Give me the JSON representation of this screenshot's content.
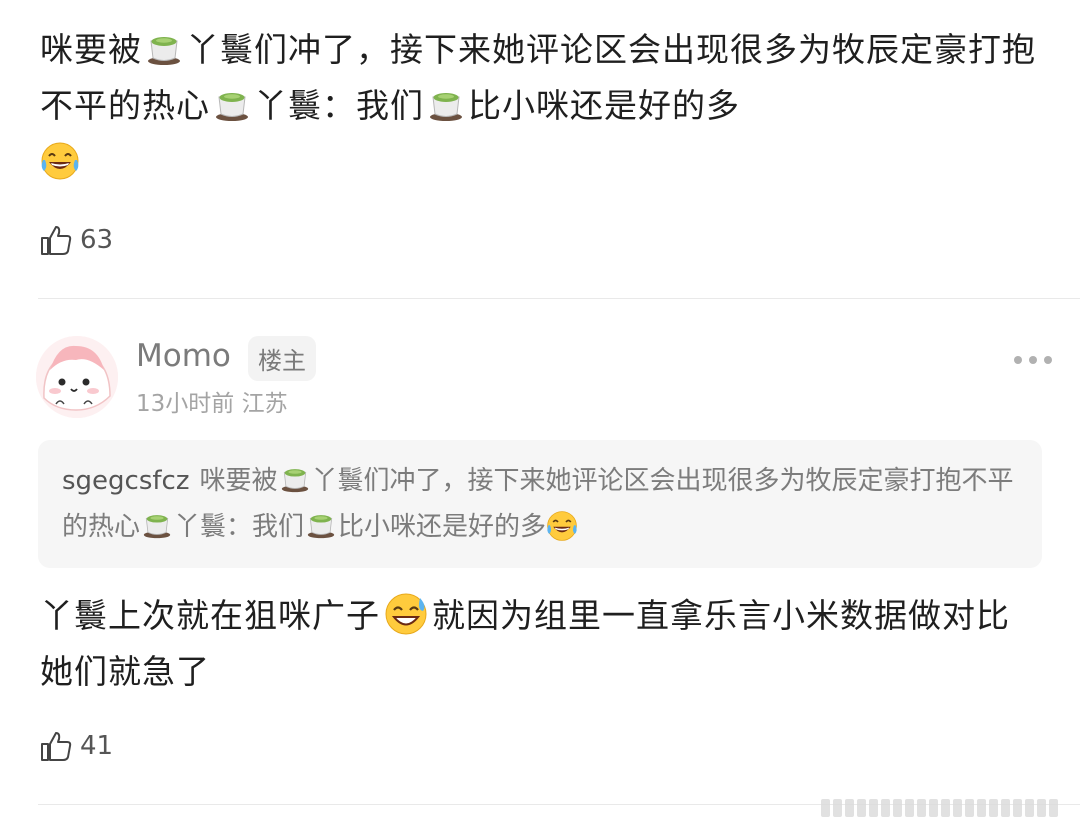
{
  "comment1": {
    "body_segments": [
      {
        "t": "text",
        "v": "咪要被"
      },
      {
        "t": "icon",
        "v": "tea-emoji"
      },
      {
        "t": "text",
        "v": "丫鬟们冲了，接下来她评论区会出现很多为牧辰定豪打抱不平的热心"
      },
      {
        "t": "icon",
        "v": "tea-emoji"
      },
      {
        "t": "text",
        "v": "丫鬟：我们"
      },
      {
        "t": "icon",
        "v": "tea-emoji"
      },
      {
        "t": "text",
        "v": "比小咪还是好的多"
      },
      {
        "t": "icon",
        "v": "laughing-emoji"
      }
    ],
    "likes": "63"
  },
  "reply": {
    "username": "Momo",
    "badge": "楼主",
    "meta": "13小时前 江苏",
    "quote": {
      "name": "sgegcsfcz",
      "segments": [
        {
          "t": "text",
          "v": "咪要被"
        },
        {
          "t": "icon",
          "v": "tea-emoji"
        },
        {
          "t": "text",
          "v": "丫鬟们冲了，接下来她评论区会出现很多为牧辰定豪打抱不平的热心"
        },
        {
          "t": "icon",
          "v": "tea-emoji"
        },
        {
          "t": "text",
          "v": "丫鬟：我们"
        },
        {
          "t": "icon",
          "v": "tea-emoji"
        },
        {
          "t": "text",
          "v": "比小咪还是好的多"
        },
        {
          "t": "icon",
          "v": "laughing-emoji"
        }
      ]
    },
    "body_segments": [
      {
        "t": "text",
        "v": "丫鬟上次就在狙咪广子"
      },
      {
        "t": "icon",
        "v": "sweat-smile-emoji"
      },
      {
        "t": "text",
        "v": "就因为组里一直拿乐言小米数据做对比 她们就急了"
      }
    ],
    "likes": "41"
  },
  "colors": {
    "text": "#1f1f1f",
    "muted": "#a4a4a4",
    "quote_bg": "#f6f6f6",
    "divider": "#e9e9e9"
  }
}
